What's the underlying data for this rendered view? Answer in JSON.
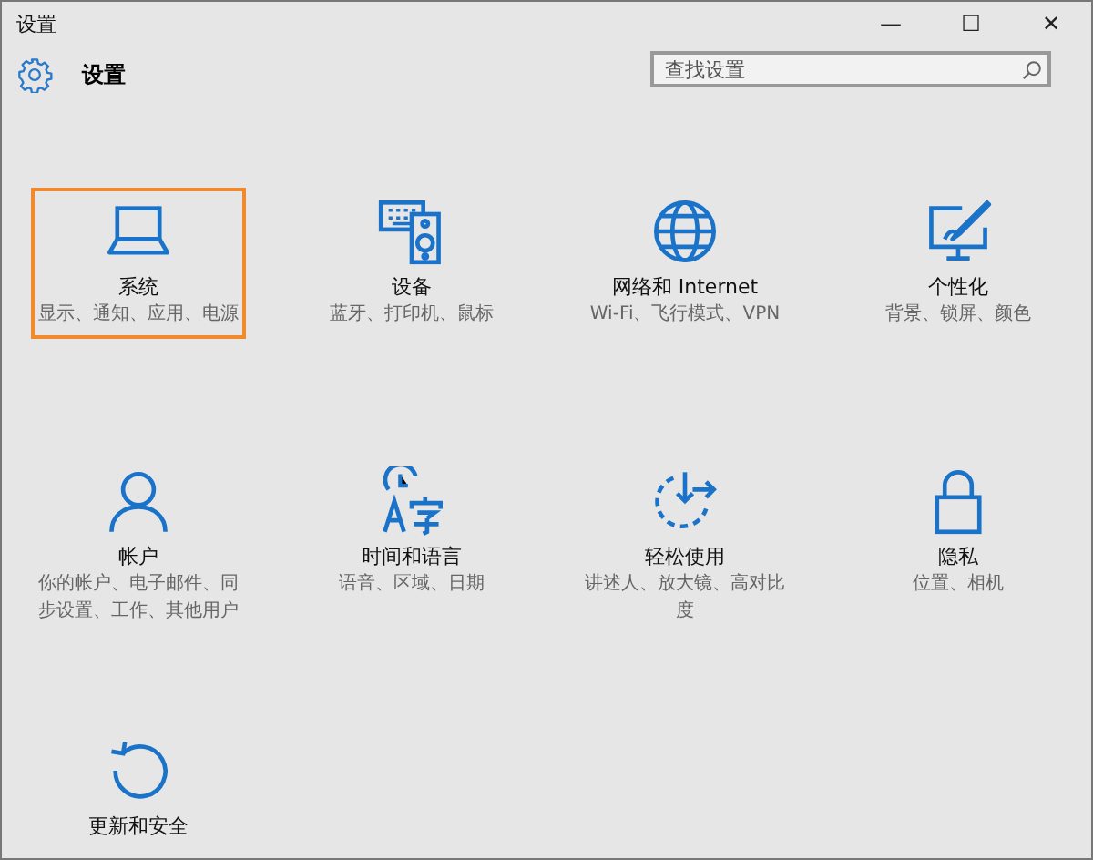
{
  "window": {
    "title": "设置",
    "controls": [
      "—",
      "☐",
      "✕"
    ]
  },
  "header": {
    "title": "设置",
    "search": {
      "placeholder": "查找设置"
    }
  },
  "tiles": [
    {
      "title": "系统",
      "description": "显示、通知、应用、电源",
      "selected": true
    },
    {
      "title": "设备",
      "description": "蓝牙、打印机、鼠标",
      "selected": false
    },
    {
      "title": "网络和 Internet",
      "description": "Wi-Fi、飞行模式、VPN",
      "selected": false
    },
    {
      "title": "个性化",
      "description": "背景、锁屏、颜色",
      "selected": false
    },
    {
      "title": "帐户",
      "description": "你的帐户、电子邮件、同步设置、工作、其他用户",
      "selected": false
    },
    {
      "title": "时间和语言",
      "description": "语音、区域、日期",
      "selected": false
    },
    {
      "title": "轻松使用",
      "description": "讲述人、放大镜、高对比度",
      "selected": false
    },
    {
      "title": "隐私",
      "description": "位置、相机",
      "selected": false
    },
    {
      "title": "更新和安全",
      "selected": false
    }
  ]
}
